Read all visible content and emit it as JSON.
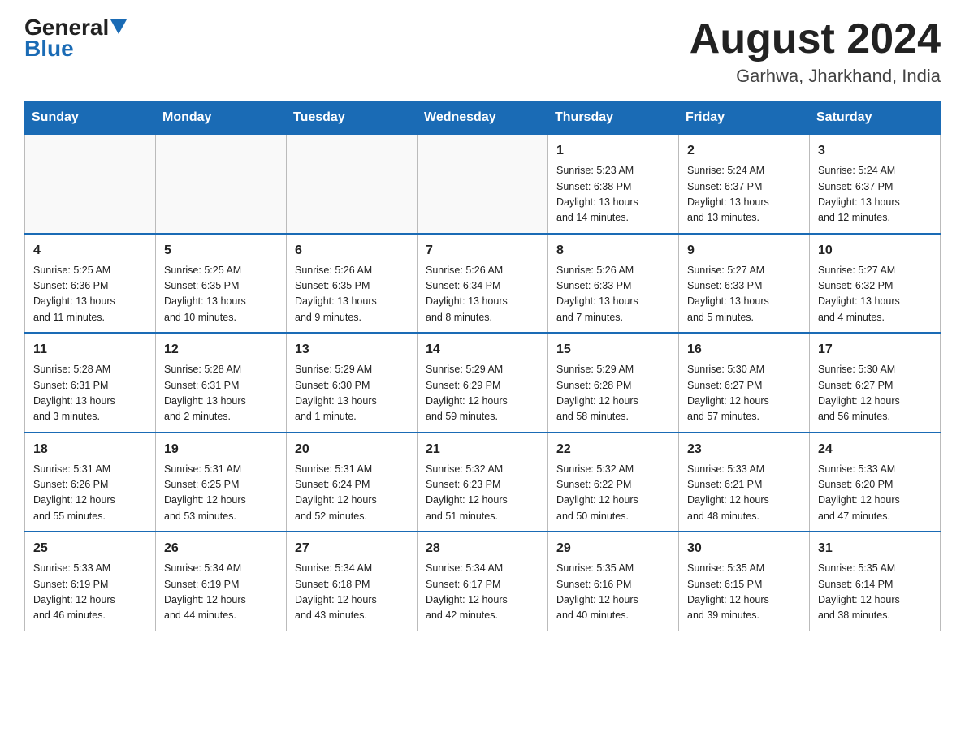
{
  "header": {
    "logo_general": "General",
    "logo_blue": "Blue",
    "month_title": "August 2024",
    "location": "Garhwa, Jharkhand, India"
  },
  "weekdays": [
    "Sunday",
    "Monday",
    "Tuesday",
    "Wednesday",
    "Thursday",
    "Friday",
    "Saturday"
  ],
  "weeks": [
    [
      {
        "day": "",
        "info": ""
      },
      {
        "day": "",
        "info": ""
      },
      {
        "day": "",
        "info": ""
      },
      {
        "day": "",
        "info": ""
      },
      {
        "day": "1",
        "info": "Sunrise: 5:23 AM\nSunset: 6:38 PM\nDaylight: 13 hours\nand 14 minutes."
      },
      {
        "day": "2",
        "info": "Sunrise: 5:24 AM\nSunset: 6:37 PM\nDaylight: 13 hours\nand 13 minutes."
      },
      {
        "day": "3",
        "info": "Sunrise: 5:24 AM\nSunset: 6:37 PM\nDaylight: 13 hours\nand 12 minutes."
      }
    ],
    [
      {
        "day": "4",
        "info": "Sunrise: 5:25 AM\nSunset: 6:36 PM\nDaylight: 13 hours\nand 11 minutes."
      },
      {
        "day": "5",
        "info": "Sunrise: 5:25 AM\nSunset: 6:35 PM\nDaylight: 13 hours\nand 10 minutes."
      },
      {
        "day": "6",
        "info": "Sunrise: 5:26 AM\nSunset: 6:35 PM\nDaylight: 13 hours\nand 9 minutes."
      },
      {
        "day": "7",
        "info": "Sunrise: 5:26 AM\nSunset: 6:34 PM\nDaylight: 13 hours\nand 8 minutes."
      },
      {
        "day": "8",
        "info": "Sunrise: 5:26 AM\nSunset: 6:33 PM\nDaylight: 13 hours\nand 7 minutes."
      },
      {
        "day": "9",
        "info": "Sunrise: 5:27 AM\nSunset: 6:33 PM\nDaylight: 13 hours\nand 5 minutes."
      },
      {
        "day": "10",
        "info": "Sunrise: 5:27 AM\nSunset: 6:32 PM\nDaylight: 13 hours\nand 4 minutes."
      }
    ],
    [
      {
        "day": "11",
        "info": "Sunrise: 5:28 AM\nSunset: 6:31 PM\nDaylight: 13 hours\nand 3 minutes."
      },
      {
        "day": "12",
        "info": "Sunrise: 5:28 AM\nSunset: 6:31 PM\nDaylight: 13 hours\nand 2 minutes."
      },
      {
        "day": "13",
        "info": "Sunrise: 5:29 AM\nSunset: 6:30 PM\nDaylight: 13 hours\nand 1 minute."
      },
      {
        "day": "14",
        "info": "Sunrise: 5:29 AM\nSunset: 6:29 PM\nDaylight: 12 hours\nand 59 minutes."
      },
      {
        "day": "15",
        "info": "Sunrise: 5:29 AM\nSunset: 6:28 PM\nDaylight: 12 hours\nand 58 minutes."
      },
      {
        "day": "16",
        "info": "Sunrise: 5:30 AM\nSunset: 6:27 PM\nDaylight: 12 hours\nand 57 minutes."
      },
      {
        "day": "17",
        "info": "Sunrise: 5:30 AM\nSunset: 6:27 PM\nDaylight: 12 hours\nand 56 minutes."
      }
    ],
    [
      {
        "day": "18",
        "info": "Sunrise: 5:31 AM\nSunset: 6:26 PM\nDaylight: 12 hours\nand 55 minutes."
      },
      {
        "day": "19",
        "info": "Sunrise: 5:31 AM\nSunset: 6:25 PM\nDaylight: 12 hours\nand 53 minutes."
      },
      {
        "day": "20",
        "info": "Sunrise: 5:31 AM\nSunset: 6:24 PM\nDaylight: 12 hours\nand 52 minutes."
      },
      {
        "day": "21",
        "info": "Sunrise: 5:32 AM\nSunset: 6:23 PM\nDaylight: 12 hours\nand 51 minutes."
      },
      {
        "day": "22",
        "info": "Sunrise: 5:32 AM\nSunset: 6:22 PM\nDaylight: 12 hours\nand 50 minutes."
      },
      {
        "day": "23",
        "info": "Sunrise: 5:33 AM\nSunset: 6:21 PM\nDaylight: 12 hours\nand 48 minutes."
      },
      {
        "day": "24",
        "info": "Sunrise: 5:33 AM\nSunset: 6:20 PM\nDaylight: 12 hours\nand 47 minutes."
      }
    ],
    [
      {
        "day": "25",
        "info": "Sunrise: 5:33 AM\nSunset: 6:19 PM\nDaylight: 12 hours\nand 46 minutes."
      },
      {
        "day": "26",
        "info": "Sunrise: 5:34 AM\nSunset: 6:19 PM\nDaylight: 12 hours\nand 44 minutes."
      },
      {
        "day": "27",
        "info": "Sunrise: 5:34 AM\nSunset: 6:18 PM\nDaylight: 12 hours\nand 43 minutes."
      },
      {
        "day": "28",
        "info": "Sunrise: 5:34 AM\nSunset: 6:17 PM\nDaylight: 12 hours\nand 42 minutes."
      },
      {
        "day": "29",
        "info": "Sunrise: 5:35 AM\nSunset: 6:16 PM\nDaylight: 12 hours\nand 40 minutes."
      },
      {
        "day": "30",
        "info": "Sunrise: 5:35 AM\nSunset: 6:15 PM\nDaylight: 12 hours\nand 39 minutes."
      },
      {
        "day": "31",
        "info": "Sunrise: 5:35 AM\nSunset: 6:14 PM\nDaylight: 12 hours\nand 38 minutes."
      }
    ]
  ]
}
